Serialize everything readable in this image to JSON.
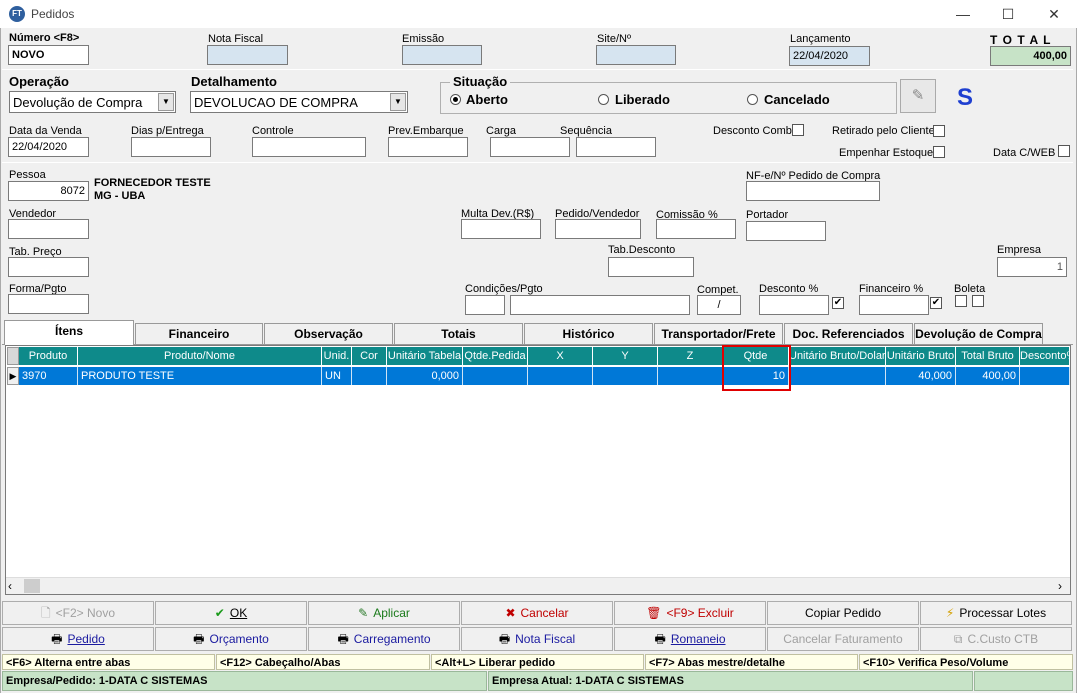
{
  "window": {
    "title": "Pedidos",
    "icon_text": "FT",
    "min": "—",
    "max": "☐",
    "close": "✕"
  },
  "header": {
    "numero_label": "Número <F8>",
    "numero_value": "NOVO",
    "nota_fiscal_label": "Nota Fiscal",
    "nota_fiscal_value": "",
    "emissao_label": "Emissão",
    "emissao_value": "",
    "site_label": "Site/Nº",
    "site_value": "",
    "lancamento_label": "Lançamento",
    "lancamento_value": "22/04/2020",
    "total_label": "T O T A L",
    "total_value": "400,00"
  },
  "operacao": {
    "label": "Operação",
    "value": "Devolução de Compra"
  },
  "detalhamento": {
    "label": "Detalhamento",
    "value": "DEVOLUCAO DE COMPRA"
  },
  "situacao": {
    "label": "Situação",
    "aberto": "Aberto",
    "liberado": "Liberado",
    "cancelado": "Cancelado",
    "selected": "aberto"
  },
  "s_mark": "S",
  "row2": {
    "data_venda_label": "Data da Venda",
    "data_venda_value": "22/04/2020",
    "dias_label": "Dias p/Entrega",
    "controle_label": "Controle",
    "prev_label": "Prev.Embarque",
    "carga_label": "Carga",
    "sequencia_label": "Sequência",
    "desconto_comb_label": "Desconto Comb.",
    "retirado_label": "Retirado pelo Cliente",
    "empenhar_label": "Empenhar Estoque",
    "data_cweb_label": "Data C/WEB"
  },
  "pessoa": {
    "label": "Pessoa",
    "code": "8072",
    "name": "FORNECEDOR TESTE",
    "location": "MG -  UBA"
  },
  "nfe_label": "NF-e/Nº Pedido de Compra",
  "vendedor_label": "Vendedor",
  "multa_label": "Multa Dev.(R$)",
  "pedido_vendedor_label": "Pedido/Vendedor",
  "comissao_label": "Comissão %",
  "portador_label": "Portador",
  "tab_preco_label": "Tab. Preço",
  "tab_desconto_label": "Tab.Desconto",
  "empresa": {
    "label": "Empresa",
    "value": "1"
  },
  "forma_label": "Forma/Pgto",
  "condicoes_label": "Condições/Pgto",
  "compet": {
    "label": "Compet.",
    "value": "/"
  },
  "desconto_pct_label": "Desconto %",
  "financeiro_pct_label": "Financeiro %",
  "boleta_label": "Boleta",
  "tabs": [
    "Ítens",
    "Financeiro",
    "Observação",
    "Totais",
    "Histórico",
    "Transportador/Frete",
    "Doc. Referenciados",
    "Devolução de Compra"
  ],
  "grid": {
    "headers": [
      "Produto",
      "Produto/Nome",
      "Unid.",
      "Cor",
      "Unitário Tabela",
      "Qtde.Pedida",
      "X",
      "Y",
      "Z",
      "Qtde",
      "Unitário Bruto/Dolar",
      "Unitário Bruto",
      "Total Bruto",
      "Desconto%"
    ],
    "row": {
      "marker": "▶",
      "produto": "3970",
      "nome": "PRODUTO TESTE",
      "unid": "UN",
      "cor": "",
      "unit_tabela": "0,000",
      "qtde_pedida": "",
      "x": "",
      "y": "",
      "z": "",
      "qtde": "10",
      "unit_dolar": "",
      "unit_bruto": "40,000",
      "total_bruto": "400,00",
      "desconto": ""
    }
  },
  "scroll": {
    "left": "‹",
    "right": "›"
  },
  "buttons_row1": {
    "novo": "<F2> Novo",
    "ok": "OK",
    "aplicar": "Aplicar",
    "cancelar": "Cancelar",
    "excluir": "<F9> Excluir",
    "copiar": "Copiar Pedido",
    "processar": "Processar Lotes"
  },
  "buttons_row2": {
    "pedido": "Pedido",
    "orcamento": "Orçamento",
    "carregamento": "Carregamento",
    "nota_fiscal": "Nota Fiscal",
    "romaneio": "Romaneio",
    "cancelar_fat": "Cancelar Faturamento",
    "custo": "C.Custo CTB"
  },
  "hints": [
    "<F6> Alterna entre abas",
    "<F12> Cabeçalho/Abas",
    "<Alt+L> Liberar pedido",
    "<F7> Abas mestre/detalhe",
    "<F10> Verifica Peso/Volume"
  ],
  "status": {
    "left": "Empresa/Pedido: 1-DATA C SISTEMAS",
    "right": "Empresa Atual: 1-DATA C SISTEMAS"
  },
  "colors": {
    "grid_header": "#0e8a8a",
    "selected_row": "#0078d7",
    "total_bg": "#c7e3c7",
    "highlight": "#e00000"
  }
}
